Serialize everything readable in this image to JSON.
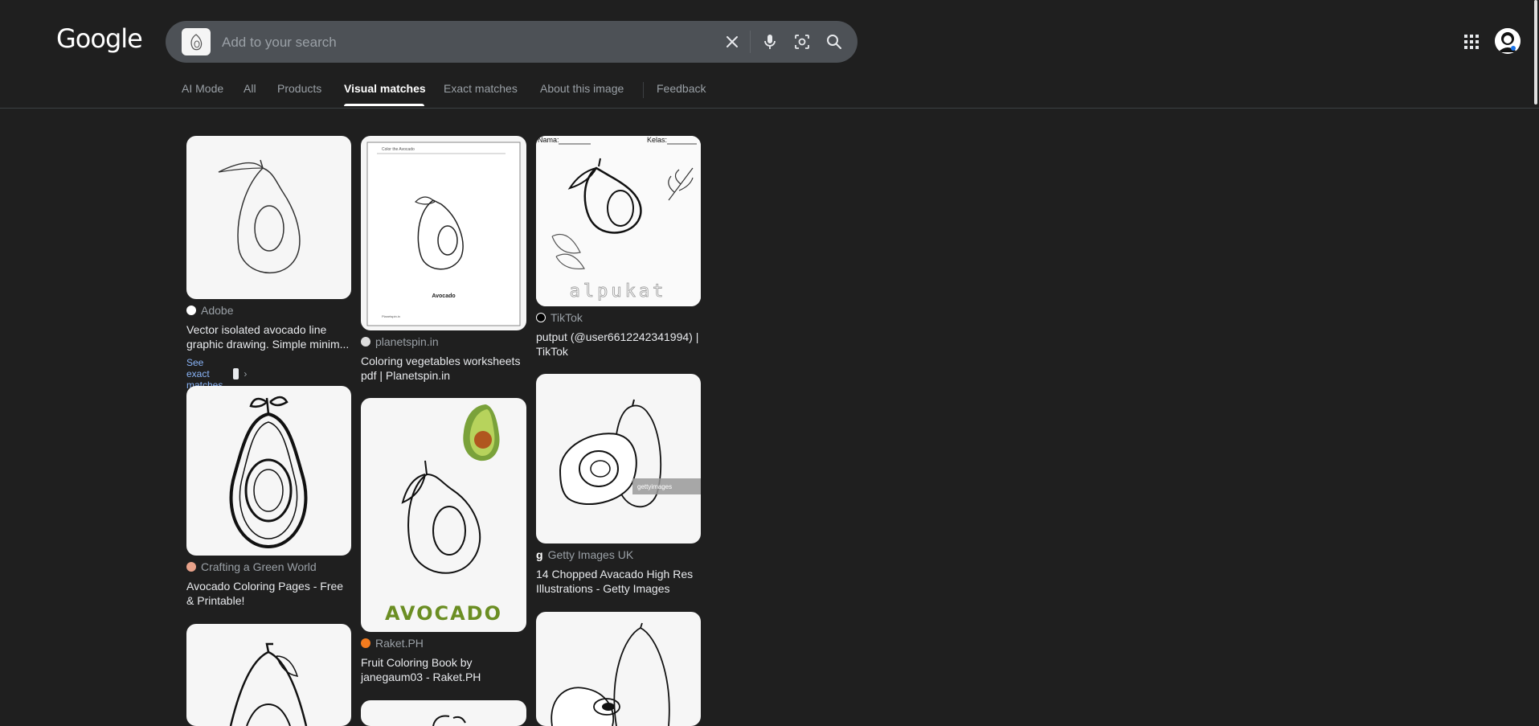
{
  "header": {
    "logo_text": "Google",
    "search_placeholder": "Add to your search",
    "icons": [
      "clear-icon",
      "mic-icon",
      "lens-icon",
      "search-icon",
      "apps-icon"
    ]
  },
  "tabs": [
    {
      "label": "AI Mode"
    },
    {
      "label": "All"
    },
    {
      "label": "Products"
    },
    {
      "label": "Visual matches",
      "active": true
    },
    {
      "label": "Exact matches"
    },
    {
      "label": "About this image"
    },
    {
      "label": "Feedback"
    }
  ],
  "results": {
    "col1": [
      {
        "source": "Adobe",
        "title": "Vector isolated avocado line graphic drawing. Simple minim...",
        "exact_label": "See exact matches"
      },
      {
        "source": "Crafting a Green World",
        "title": "Avocado Coloring Pages - Free & Printable!"
      }
    ],
    "col2": [
      {
        "source": "planetspin.in",
        "title": "Coloring vegetables worksheets pdf | Planetspin.in",
        "img_caption": "Avocado",
        "img_header": "Color the Avocado",
        "img_footer": "Planetspin.in"
      },
      {
        "source": "Raket.PH",
        "title": "Fruit Coloring Book by janegaum03 - Raket.PH",
        "img_caption": "AVOCADO"
      }
    ],
    "col3": [
      {
        "source": "TikTok",
        "title": "putput (@user6612242341994) | TikTok",
        "img_label_left": "Nama:",
        "img_label_right": "Kelas:",
        "img_word": "alpukat"
      },
      {
        "source": "Getty Images UK",
        "title": "14 Chopped Avacado High Res Illustrations - Getty Images",
        "img_watermark": "gettyimages"
      }
    ]
  },
  "colors": {
    "background": "#1f1f1f",
    "search_bg": "#4d5156",
    "link": "#8ab4f8",
    "avocado_green": "#6b8e23"
  }
}
